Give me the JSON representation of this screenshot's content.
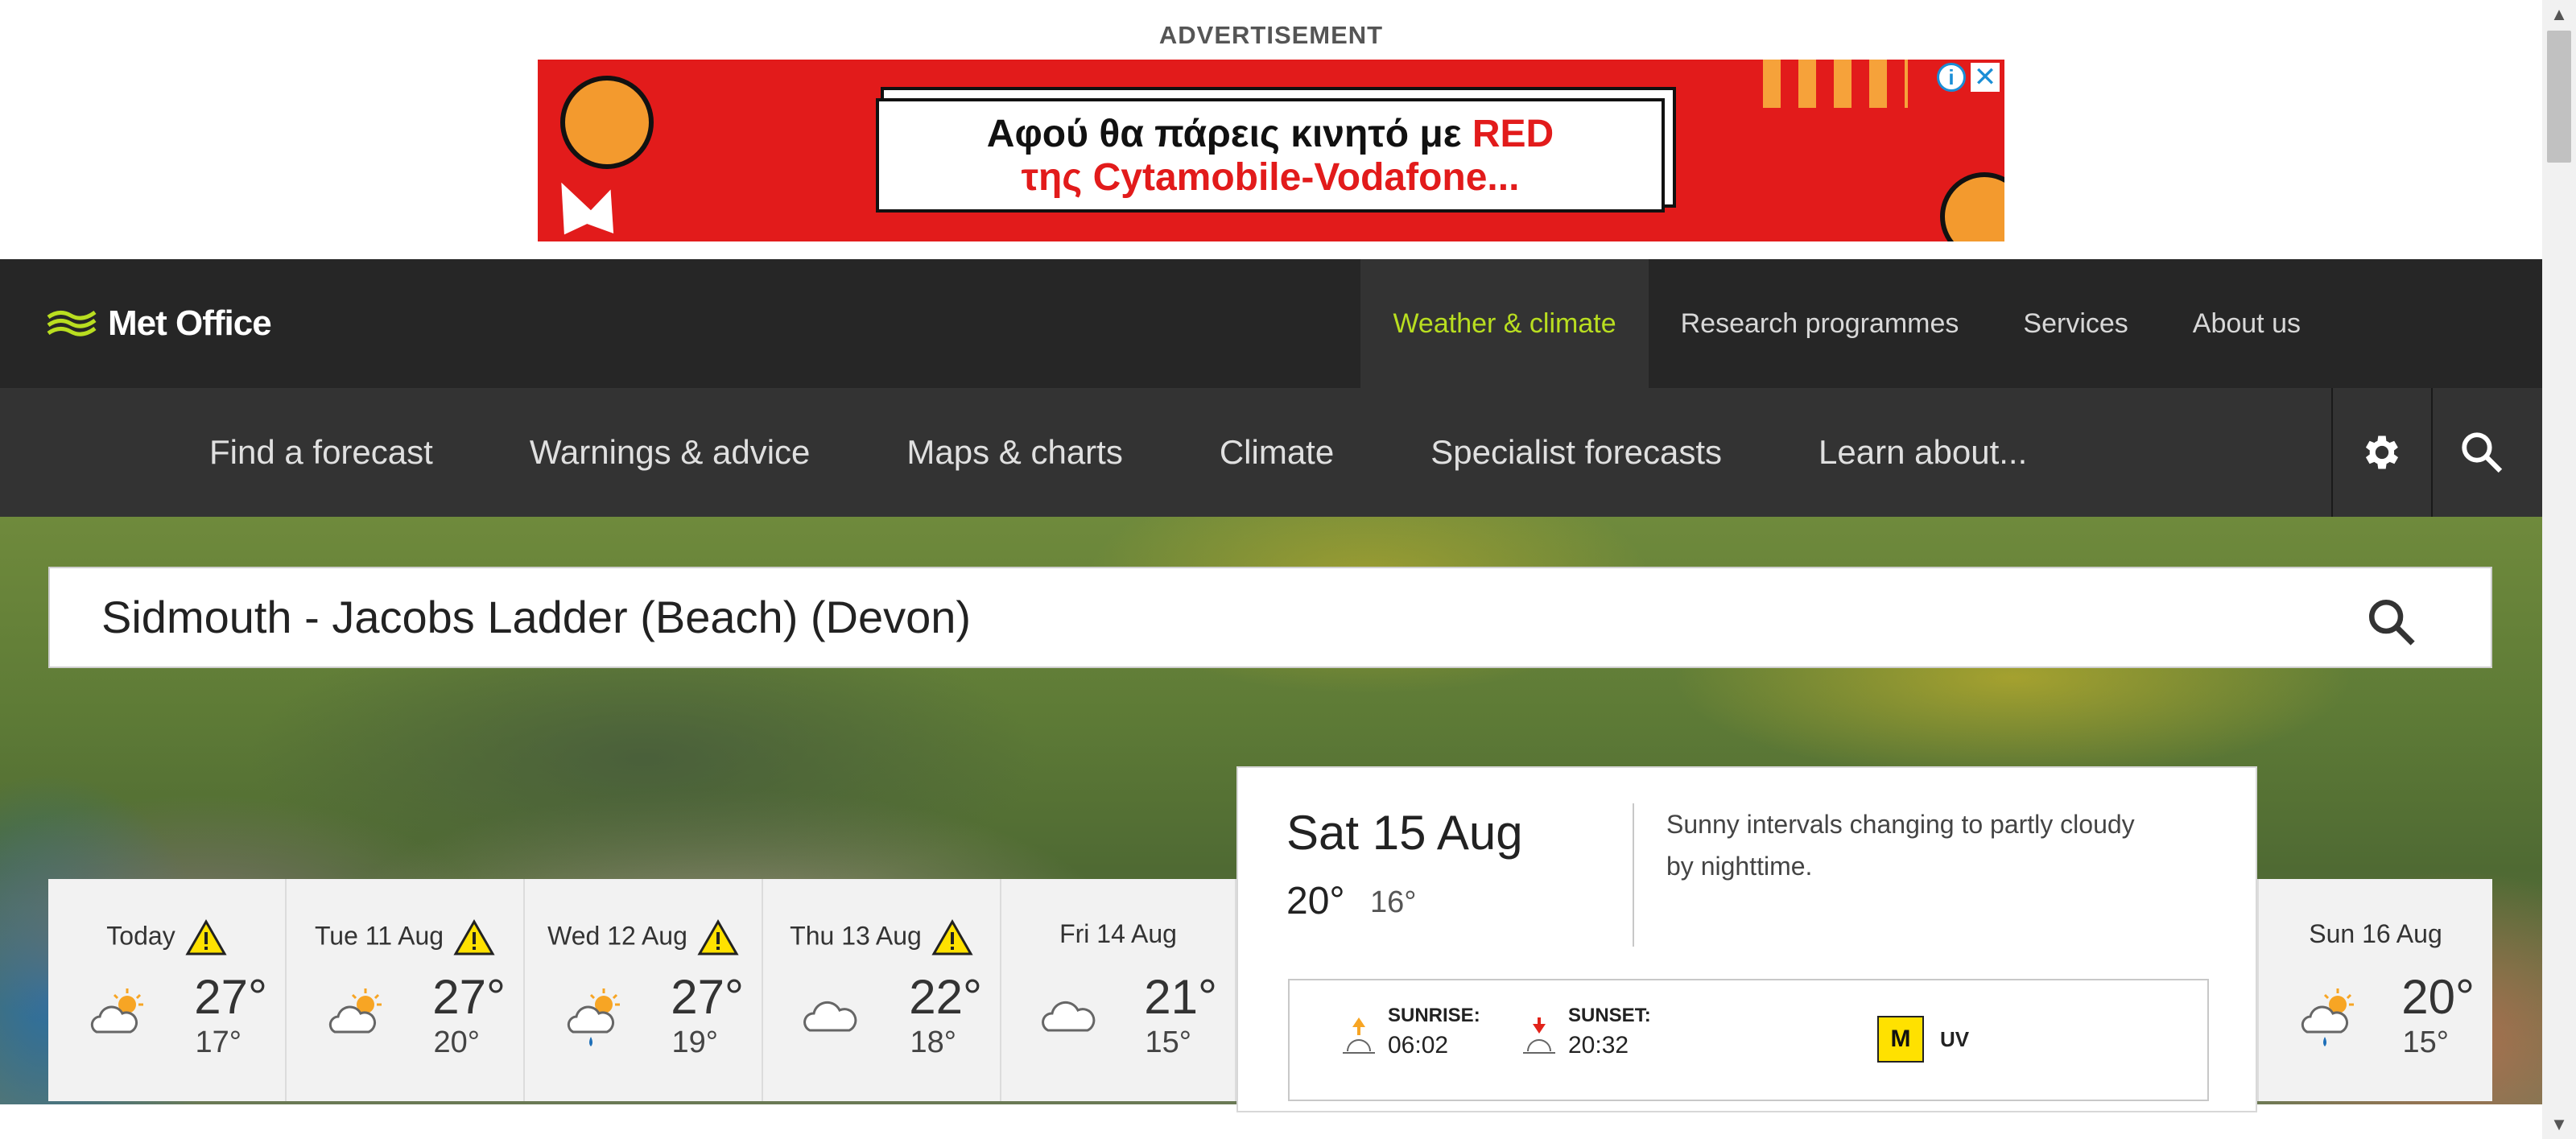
{
  "advertisement": {
    "label": "ADVERTISEMENT",
    "line1_prefix": "Αφού θα πάρεις κινητό με ",
    "line1_highlight": "RED",
    "line2": "της Cytamobile-Vodafone...",
    "info_icon": "info-icon",
    "close_icon": "close-icon"
  },
  "header": {
    "logo_text": "Met Office",
    "top_links": [
      "Weather & climate",
      "Research programmes",
      "Services",
      "About us"
    ],
    "active_top_link": "Weather & climate",
    "sub_nav": [
      "Find a forecast",
      "Warnings & advice",
      "Maps & charts",
      "Climate",
      "Specialist forecasts",
      "Learn about..."
    ],
    "accent_color": "#b9de20"
  },
  "search": {
    "value": "Sidmouth - Jacobs Ladder (Beach) (Devon)"
  },
  "forecast": {
    "days": [
      {
        "label": "Today",
        "warning": true,
        "icon": "sunny-intervals-icon",
        "max": "27°",
        "min": "17°"
      },
      {
        "label": "Tue 11 Aug",
        "warning": true,
        "icon": "sunny-intervals-icon",
        "max": "27°",
        "min": "20°"
      },
      {
        "label": "Wed 12 Aug",
        "warning": true,
        "icon": "sunny-shower-icon",
        "max": "27°",
        "min": "19°"
      },
      {
        "label": "Thu 13 Aug",
        "warning": true,
        "icon": "cloudy-icon",
        "max": "22°",
        "min": "18°"
      },
      {
        "label": "Fri 14 Aug",
        "warning": false,
        "icon": "cloudy-icon",
        "max": "21°",
        "min": "15°"
      },
      {
        "label": "Sun 16 Aug",
        "warning": false,
        "icon": "sunny-shower-icon",
        "max": "20°",
        "min": "15°"
      }
    ],
    "selected": {
      "date": "Sat 15 Aug",
      "max": "20°",
      "min": "16°",
      "description": "Sunny intervals changing to partly cloudy by nighttime.",
      "sunrise_label": "SUNRISE:",
      "sunrise_time": "06:02",
      "sunset_label": "SUNSET:",
      "sunset_time": "20:32",
      "uv_value": "M",
      "uv_label": "UV"
    },
    "warning_color": "#ffe100"
  }
}
